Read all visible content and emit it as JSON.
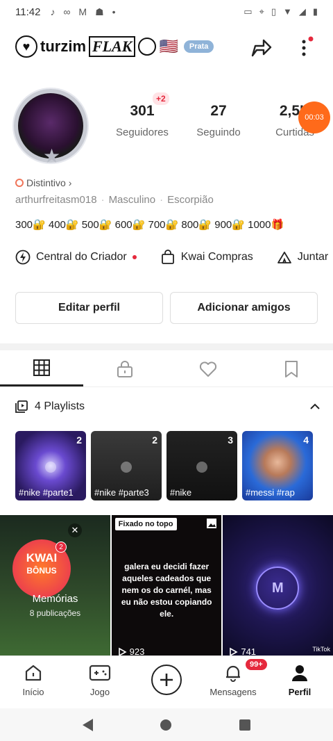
{
  "status_bar": {
    "time": "11:42",
    "left_icons": [
      "tiktok-icon",
      "infinity-icon",
      "gmail-icon",
      "person-icon",
      "dot-icon"
    ],
    "right_icons": [
      "cast-icon",
      "location-icon",
      "vibrate-icon",
      "wifi-icon",
      "signal-icon",
      "battery-icon"
    ]
  },
  "header": {
    "nickname_part1": "turzim",
    "nickname_part2": "FLAK",
    "flag": "🇺🇸",
    "rank_badge": "Prata"
  },
  "profile": {
    "plus_badge": "+2",
    "timer": "00:03",
    "stats": [
      {
        "value": "301",
        "label": "Seguidores"
      },
      {
        "value": "27",
        "label": "Seguindo"
      },
      {
        "value": "2,5K",
        "label": "Curtidas"
      }
    ],
    "distintivo": "Distintivo",
    "username": "arthurfreitasm018",
    "gender": "Masculino",
    "sign": "Escorpião",
    "lock_line": "300🔐 400🔐 500🔐 600🔐 700🔐 800🔐 900🔐 1000🎁"
  },
  "creator_row": {
    "central": "Central do Criador",
    "shop": "Kwai Compras",
    "join": "Juntar"
  },
  "buttons": {
    "edit": "Editar perfil",
    "add_friends": "Adicionar amigos"
  },
  "playlists": {
    "title": "4 Playlists",
    "items": [
      {
        "count": "2",
        "caption": "#nike #parte1",
        "color": "#3b2a7a"
      },
      {
        "count": "2",
        "caption": "#nike #parte3",
        "color": "#2a2a2a"
      },
      {
        "count": "3",
        "caption": "#nike",
        "color": "#1a1a1a"
      },
      {
        "count": "4",
        "caption": "#messi #rap",
        "color": "#2a6ad8"
      }
    ]
  },
  "grid": {
    "memories": {
      "kwai": "KWAI",
      "bonus": "BÔNUS",
      "badge": "2",
      "title": "Memórias",
      "subtitle": "8 publicações"
    },
    "pinned": {
      "label": "Fixado no topo",
      "text": "galera eu decidi fazer aqueles cadeados que nem os do carnél, mas eu não estou copiando ele.",
      "views": "923"
    },
    "third": {
      "logo": "M",
      "views": "741",
      "watermark": "TikTok"
    }
  },
  "bottom_nav": {
    "home": "Início",
    "game": "Jogo",
    "messages": "Mensagens",
    "messages_badge": "99+",
    "profile": "Perfil"
  }
}
